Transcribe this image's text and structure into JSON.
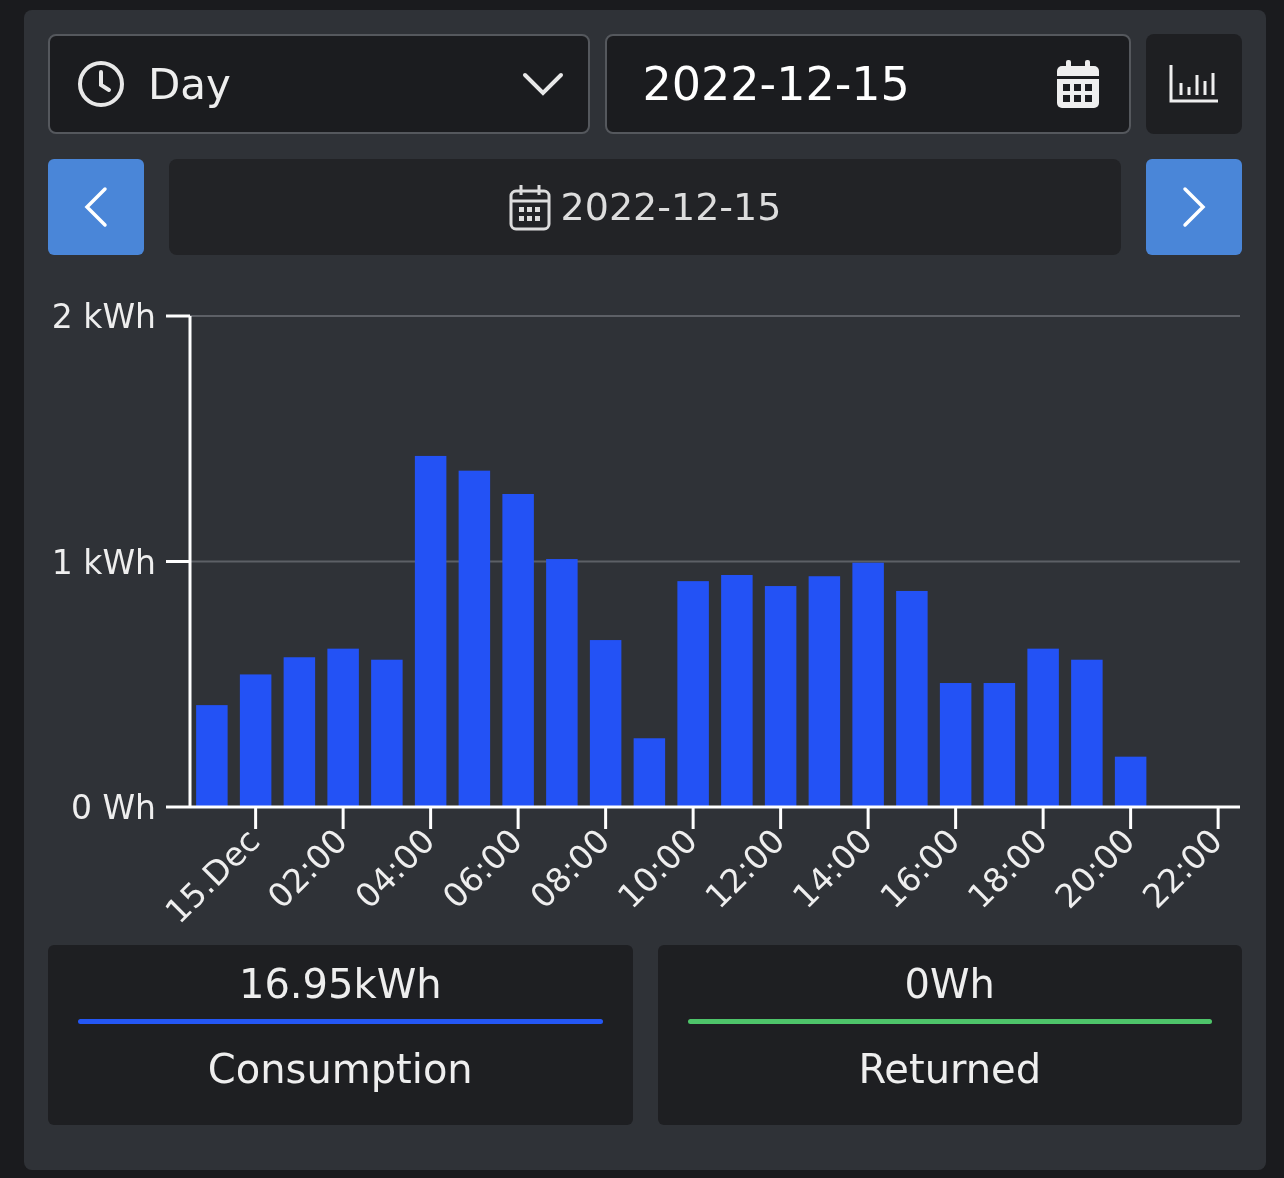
{
  "period_select": {
    "value": "Day"
  },
  "date_field": {
    "value": "2022-12-15"
  },
  "nav": {
    "date": "2022-12-15"
  },
  "chart": {
    "chart_data": {
      "type": "bar",
      "x": [
        -1,
        0,
        1,
        2,
        3,
        4,
        5,
        6,
        7,
        8,
        9,
        10,
        11,
        12,
        13,
        14,
        15,
        16,
        17,
        18,
        19,
        20
      ],
      "series": [
        {
          "color": "#2352f5",
          "values": [
            0.415,
            0.54,
            0.61,
            0.645,
            0.6,
            1.43,
            1.37,
            1.275,
            1.01,
            0.68,
            0.28,
            0.92,
            0.945,
            0.9,
            0.94,
            0.995,
            0.88,
            0.505,
            0.505,
            0.645,
            0.6,
            0.205
          ]
        }
      ],
      "xlim": [
        -1.5,
        22.5
      ],
      "ylim": [
        0,
        2
      ],
      "xticks": [
        {
          "value": 0,
          "label": "15.Dec"
        },
        {
          "value": 2,
          "label": "02:00"
        },
        {
          "value": 4,
          "label": "04:00"
        },
        {
          "value": 6,
          "label": "06:00"
        },
        {
          "value": 8,
          "label": "08:00"
        },
        {
          "value": 10,
          "label": "10:00"
        },
        {
          "value": 12,
          "label": "12:00"
        },
        {
          "value": 14,
          "label": "14:00"
        },
        {
          "value": 16,
          "label": "16:00"
        },
        {
          "value": 18,
          "label": "18:00"
        },
        {
          "value": 20,
          "label": "20:00"
        },
        {
          "value": 22,
          "label": "22:00"
        }
      ],
      "yticks": [
        {
          "value": 0,
          "label": "0 Wh"
        },
        {
          "value": 1,
          "label": "1 kWh"
        },
        {
          "value": 2,
          "label": "2 kWh"
        }
      ]
    }
  },
  "totals": [
    {
      "value": "16.95kWh",
      "label": "Consumption",
      "color": "#2457f5"
    },
    {
      "value": "0Wh",
      "label": "Returned",
      "color": "#4ec46a"
    }
  ]
}
